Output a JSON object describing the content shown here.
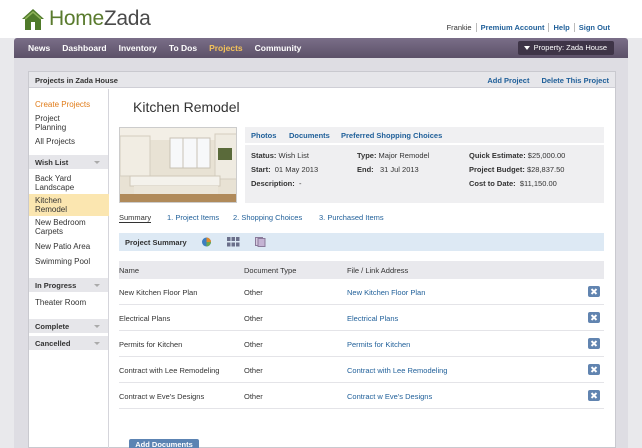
{
  "brand": {
    "name_part1": "Home",
    "name_part2": "Zada"
  },
  "top_links": {
    "user": "Frankie",
    "premium": "Premium Account",
    "help": "Help",
    "signout": "Sign Out"
  },
  "nav": {
    "items": [
      "News",
      "Dashboard",
      "Inventory",
      "To Dos",
      "Projects",
      "Community"
    ],
    "active_index": 4,
    "property_button": "Property: Zada House"
  },
  "panel": {
    "title": "Projects in Zada House",
    "add_project": "Add Project",
    "delete_project": "Delete This Project"
  },
  "sidebar": {
    "top_links": [
      "Create Projects",
      "Project Planning",
      "All Projects"
    ],
    "groups": [
      {
        "label": "Wish List",
        "items": [
          "Back Yard Landscape",
          "Kitchen Remodel",
          "New Bedroom Carpets",
          "New Patio Area",
          "Swimming Pool"
        ],
        "selected_index": 1
      },
      {
        "label": "In Progress",
        "items": [
          "Theater Room"
        ]
      },
      {
        "label": "Complete",
        "items": []
      },
      {
        "label": "Cancelled",
        "items": []
      }
    ]
  },
  "project": {
    "title": "Kitchen Remodel",
    "info_tabs": [
      "Photos",
      "Documents",
      "Preferred Shopping Choices"
    ],
    "status_label": "Status:",
    "status": "Wish List",
    "type_label": "Type:",
    "type": "Major Remodel",
    "quick_estimate_label": "Quick Estimate:",
    "quick_estimate": "$25,000.00",
    "start_label": "Start:",
    "start": "01 May 2013",
    "end_label": "End:",
    "end": "31 Jul 2013",
    "budget_label": "Project Budget:",
    "budget": "$28,837.50",
    "description_label": "Description:",
    "description": "-",
    "cost_label": "Cost to Date:",
    "cost": "$11,150.00"
  },
  "subtabs": [
    "Summary",
    "1. Project Items",
    "2. Shopping Choices",
    "3. Purchased Items"
  ],
  "summary_bar": {
    "label": "Project Summary"
  },
  "table": {
    "headers": [
      "Name",
      "Document Type",
      "File / Link Address"
    ],
    "rows": [
      {
        "name": "New Kitchen Floor Plan",
        "type": "Other",
        "link": "New Kitchen Floor Plan"
      },
      {
        "name": "Electrical Plans",
        "type": "Other",
        "link": "Electrical Plans"
      },
      {
        "name": "Permits for Kitchen",
        "type": "Other",
        "link": "Permits for Kitchen"
      },
      {
        "name": "Contract with Lee Remodeling",
        "type": "Other",
        "link": "Contract with Lee Remodeling"
      },
      {
        "name": "Contract w Eve's Designs",
        "type": "Other",
        "link": "Contract w Eve's Designs"
      }
    ]
  },
  "add_documents_button": "Add Documents",
  "colors": {
    "nav_bg": "#5c5168",
    "accent_orange": "#e07b18",
    "link_blue": "#1f5f99",
    "brand_green": "#5a7b2e",
    "selected_bg": "#fbe6b0"
  }
}
